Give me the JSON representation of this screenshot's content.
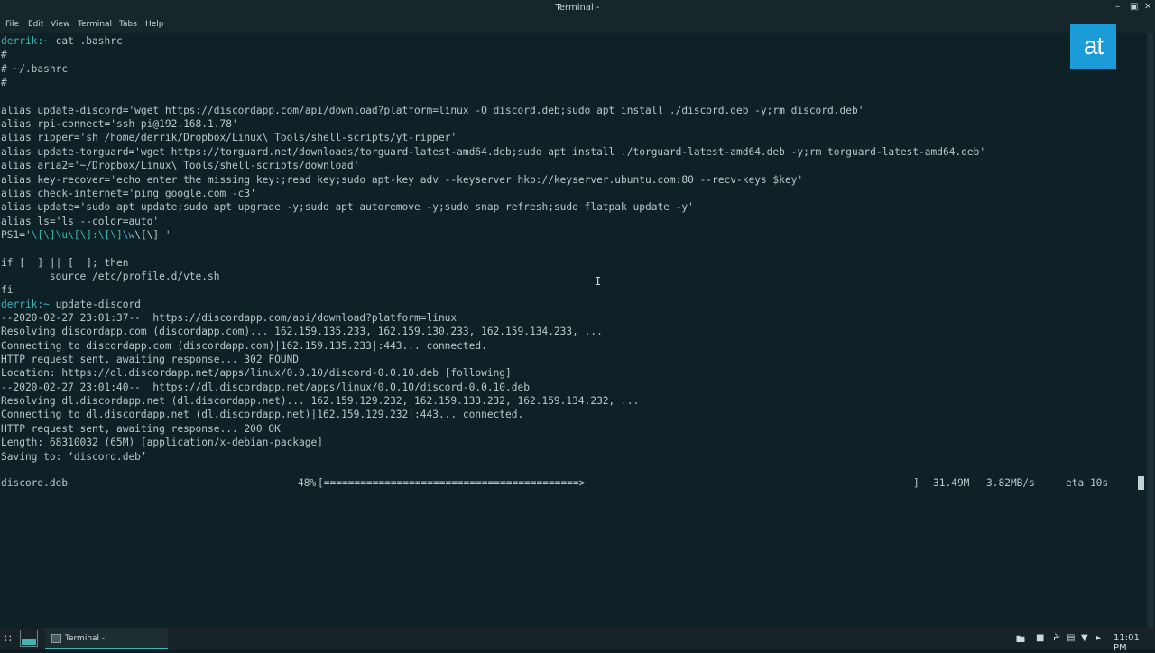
{
  "window": {
    "title": "Terminal -"
  },
  "menu": [
    "File",
    "Edit",
    "View",
    "Terminal",
    "Tabs",
    "Help"
  ],
  "logo": {
    "text": "at",
    "color": "#1b9bd8"
  },
  "terminal": {
    "lines": [
      {
        "prompt": "derrik:~",
        "text": " cat .bashrc"
      },
      {
        "text": "#"
      },
      {
        "text": "# ~/.bashrc"
      },
      {
        "text": "#"
      },
      {
        "text": ""
      },
      {
        "text": "alias update-discord='wget https://discordapp.com/api/download?platform=linux -O discord.deb;sudo apt install ./discord.deb -y;rm discord.deb'"
      },
      {
        "text": "alias rpi-connect='ssh pi@192.168.1.78'"
      },
      {
        "text": "alias ripper='sh /home/derrik/Dropbox/Linux\\ Tools/shell-scripts/yt-ripper'"
      },
      {
        "text": "alias update-torguard='wget https://torguard.net/downloads/torguard-latest-amd64.deb;sudo apt install ./torguard-latest-amd64.deb -y;rm torguard-latest-amd64.deb'"
      },
      {
        "text": "alias aria2='~/Dropbox/Linux\\ Tools/shell-scripts/download'"
      },
      {
        "text": "alias key-recover='echo enter the missing key:;read key;sudo apt-key adv --keyserver hkp://keyserver.ubuntu.com:80 --recv-keys $key'"
      },
      {
        "text": "alias check-internet='ping google.com -c3'"
      },
      {
        "text": "alias update='sudo apt update;sudo apt upgrade -y;sudo apt autoremove -y;sudo snap refresh;sudo flatpak update -y'"
      },
      {
        "text": "alias ls='ls --color=auto'"
      },
      {
        "ps1": [
          "PS1='",
          "\\[\\]\\u\\[\\]:\\[\\]",
          "\\w",
          "\\[\\] '"
        ]
      },
      {
        "text": ""
      },
      {
        "text": "if [  ] || [  ]; then"
      },
      {
        "text": "        source /etc/profile.d/vte.sh"
      },
      {
        "text": "fi"
      },
      {
        "prompt": "derrik:~",
        "text": " update-discord"
      },
      {
        "text": "--2020-02-27 23:01:37--  https://discordapp.com/api/download?platform=linux"
      },
      {
        "text": "Resolving discordapp.com (discordapp.com)... 162.159.135.233, 162.159.130.233, 162.159.134.233, ..."
      },
      {
        "text": "Connecting to discordapp.com (discordapp.com)|162.159.135.233|:443... connected."
      },
      {
        "text": "HTTP request sent, awaiting response... 302 FOUND"
      },
      {
        "text": "Location: https://dl.discordapp.net/apps/linux/0.0.10/discord-0.0.10.deb [following]"
      },
      {
        "text": "--2020-02-27 23:01:40--  https://dl.discordapp.net/apps/linux/0.0.10/discord-0.0.10.deb"
      },
      {
        "text": "Resolving dl.discordapp.net (dl.discordapp.net)... 162.159.129.232, 162.159.133.232, 162.159.134.232, ..."
      },
      {
        "text": "Connecting to dl.discordapp.net (dl.discordapp.net)|162.159.129.232|:443... connected."
      },
      {
        "text": "HTTP request sent, awaiting response... 200 OK"
      },
      {
        "text": "Length: 68310032 (65M) [application/x-debian-package]"
      },
      {
        "text": "Saving to: ‘discord.deb’"
      }
    ],
    "progress": {
      "file": "discord.deb",
      "percent_label": "48%",
      "bar": "[==========================================>",
      "bar_end": "]",
      "size": "31.49M",
      "speed": "3.82MB/s",
      "eta": "eta 10s"
    }
  },
  "taskbar": {
    "task_label": "Terminal -",
    "clock": "11:01 PM"
  }
}
